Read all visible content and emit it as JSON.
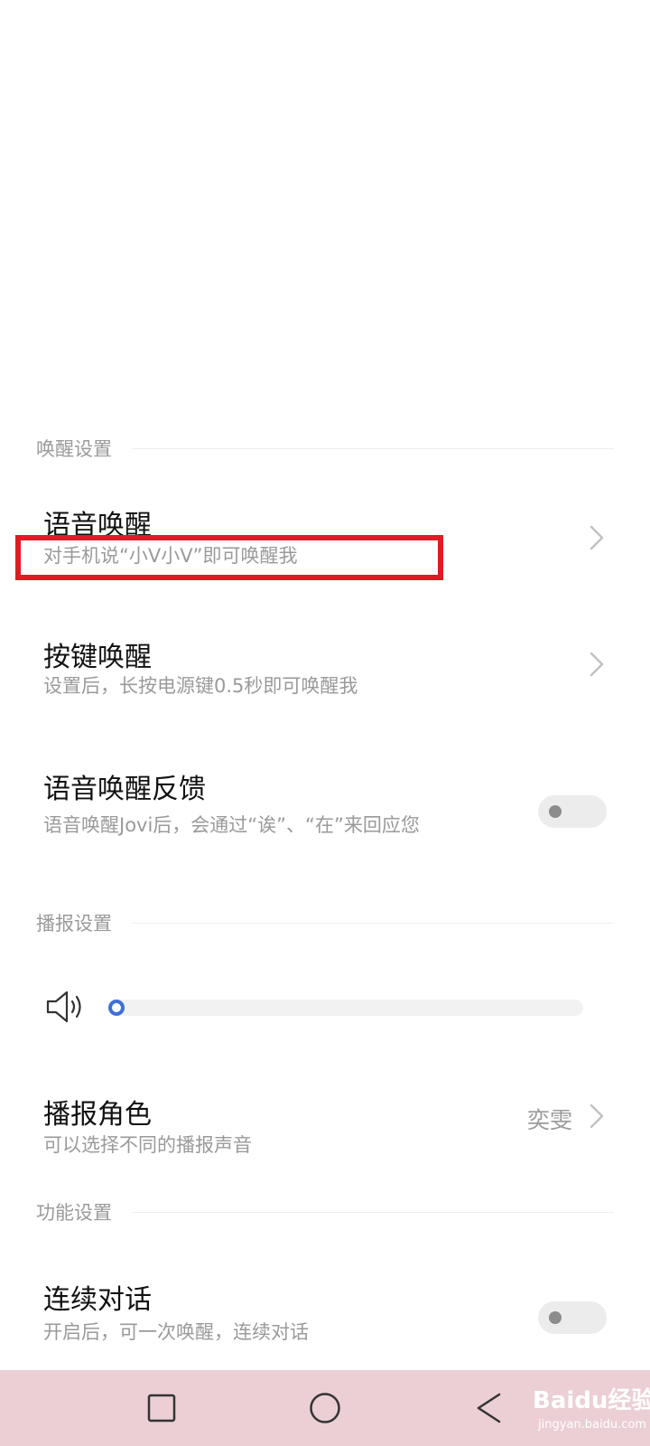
{
  "sections": {
    "wake": {
      "label": "唤醒设置"
    },
    "broadcast": {
      "label": "播报设置"
    },
    "function": {
      "label": "功能设置"
    }
  },
  "voice_wake": {
    "title": "语音唤醒",
    "subtitle": "对手机说“小V小V”即可唤醒我"
  },
  "key_wake": {
    "title": "按键唤醒",
    "subtitle": "设置后，长按电源键0.5秒即可唤醒我"
  },
  "wake_feedback": {
    "title": "语音唤醒反馈",
    "subtitle": "语音唤醒Jovi后，会通过“诶”、“在”来回应您",
    "enabled": false
  },
  "volume": {
    "level": 0,
    "icon": "speaker-icon"
  },
  "voice_role": {
    "title": "播报角色",
    "subtitle": "可以选择不同的播报声音",
    "value": "奕雯"
  },
  "continuous_dialog": {
    "title": "连续对话",
    "subtitle": "开启后，可一次唤醒，连续对话",
    "enabled": false
  },
  "watermark": {
    "main": "Baidu经验",
    "sub": "jingyan.baidu.com"
  },
  "colors": {
    "accent": "#3f6fd8",
    "highlight": "#e01b24",
    "navbar": "#ebcfd5"
  }
}
